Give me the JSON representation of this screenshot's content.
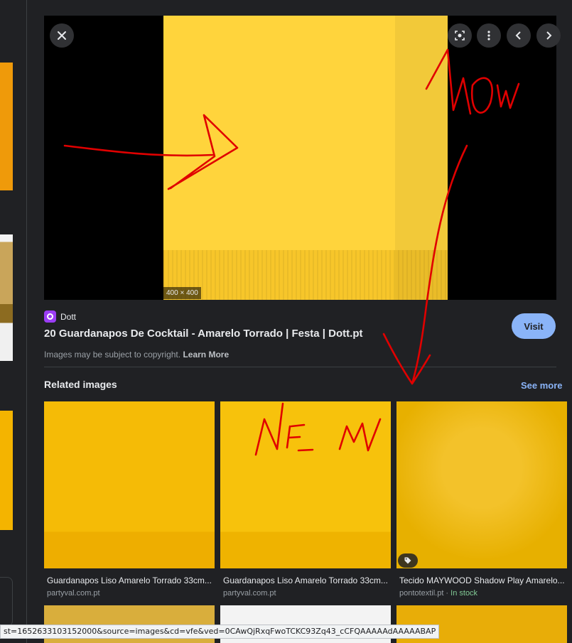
{
  "viewer": {
    "dimensions": "400 × 400",
    "buttons": [
      "close-icon",
      "lens-icon",
      "more-vert-icon",
      "chevron-left-icon",
      "chevron-right-icon"
    ]
  },
  "source": {
    "site_name": "Dott",
    "title": "20 Guardanapos De Cocktail - Amarelo Torrado | Festa | Dott.pt",
    "visit_label": "Visit",
    "copyright_text": "Images may be subject to copyright.",
    "learn_more": "Learn More"
  },
  "related": {
    "heading": "Related images",
    "see_more": "See more",
    "items": [
      {
        "caption": "Guardanapos Liso Amarelo Torrado 33cm...",
        "host": "partyval.com.pt"
      },
      {
        "caption": "Guardanapos Liso Amarelo Torrado 33cm...",
        "host": "partyval.com.pt"
      },
      {
        "caption": "Tecido MAYWOOD Shadow Play Amarelo...",
        "host": "pontotextil.pt",
        "stock": "In stock"
      }
    ]
  },
  "status_url": "st=1652633103152000&source=images&cd=vfe&ved=0CAwQjRxqFwoTCKC93Zq43_cCFQAAAAAdAAAAABAP",
  "annotations": {
    "word1": "WOW",
    "word2": "NEW"
  },
  "colors": {
    "accent": "#8ab4f8",
    "background": "#202124",
    "annotation": "#e00000",
    "in_stock": "#81c995"
  }
}
